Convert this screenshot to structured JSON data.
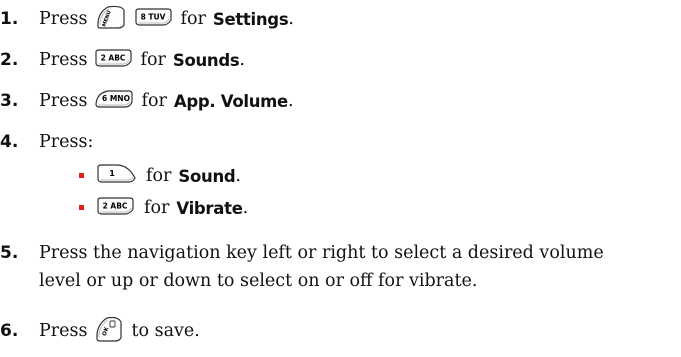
{
  "steps": [
    {
      "number": "1.",
      "press": "Press",
      "for_word": "for",
      "target": "Settings",
      "end": ".",
      "keys": [
        "menu-key",
        "8-tuv-key"
      ],
      "key_labels": [
        "MENU",
        "8 TUV"
      ]
    },
    {
      "number": "2.",
      "press": "Press",
      "for_word": "for",
      "target": "Sounds",
      "end": ".",
      "keys": [
        "2-abc-key"
      ],
      "key_labels": [
        "2 ABC"
      ]
    },
    {
      "number": "3.",
      "press": "Press",
      "for_word": "for",
      "target": "App. Volume",
      "end": ".",
      "keys": [
        "6-mno-key"
      ],
      "key_labels": [
        "6 MNO"
      ]
    },
    {
      "number": "4.",
      "text": "Press:"
    },
    {
      "number": "5.",
      "line1": "Press the navigation key left or right to select a desired volume",
      "line2": "level or up or down to select on or off for vibrate."
    },
    {
      "number": "6.",
      "press": "Press",
      "after": "to save.",
      "keys": [
        "ok-key"
      ],
      "key_labels": [
        "OK"
      ]
    }
  ],
  "sub_items": [
    {
      "for_word": "for",
      "target": "Sound",
      "end": ".",
      "keys": [
        "1-key"
      ],
      "key_labels": [
        "1"
      ]
    },
    {
      "for_word": "for",
      "target": "Vibrate",
      "end": ".",
      "keys": [
        "2-abc-key"
      ],
      "key_labels": [
        "2 ABC"
      ]
    }
  ],
  "colors": {
    "bullet": "#e8201b",
    "key_outline": "#333333"
  }
}
